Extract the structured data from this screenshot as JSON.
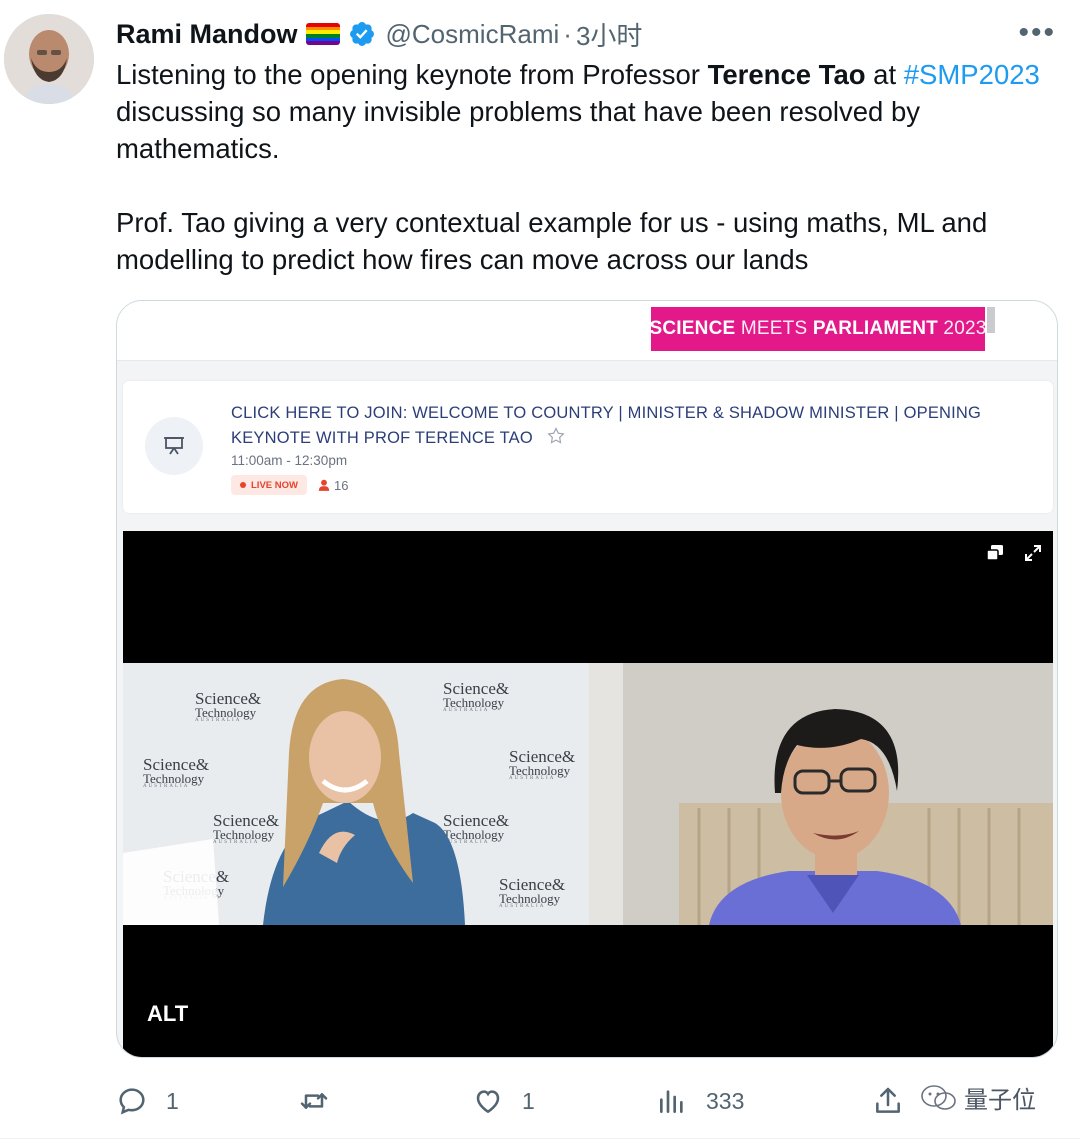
{
  "tweet": {
    "author_name": "Rami Mandow",
    "author_flag": "rainbow-flag",
    "verified_icon": "verified-badge-icon",
    "handle": "@CosmicRami",
    "separator": "·",
    "time_ago": "3小时",
    "more_icon": "more-options-icon",
    "paragraph1": {
      "part1": "Listening to the opening keynote from Professor ",
      "bold": "Terence Tao",
      "part2": " at ",
      "hashtag": "#SMP2023",
      "part3": " discussing so many invisible problems that have been resolved by mathematics."
    },
    "paragraph2": "Prof. Tao giving a very contextual example for us - using maths, ML and modelling to predict how fires can move across our lands"
  },
  "media": {
    "banner": {
      "science": "SCIENCE",
      "meets": " MEETS ",
      "parliament": "PARLIAMENT",
      "year": " 2023"
    },
    "session": {
      "icon": "presentation-icon",
      "title": "CLICK HERE TO JOIN: WELCOME TO COUNTRY | MINISTER & SHADOW MINISTER | OPENING KEYNOTE WITH PROF TERENCE TAO",
      "star_icon": "star-icon",
      "time": "11:00am - 12:30pm",
      "live_label": "LIVE NOW",
      "attendee_count": "16"
    },
    "video": {
      "alt_label": "ALT",
      "backdrop_logo": {
        "science": "Science",
        "amp": "&",
        "technology": "Technology",
        "australia": "AUSTRALIA"
      }
    }
  },
  "actions": {
    "reply_count": "1",
    "retweet_count": "",
    "like_count": "1",
    "views_count": "333"
  },
  "watermark": "量子位",
  "colors": {
    "accent": "#1d9bf0",
    "banner_pink": "#e3198a",
    "session_title": "#2c3e7a",
    "live_red": "#e8432d",
    "muted": "#536471"
  }
}
